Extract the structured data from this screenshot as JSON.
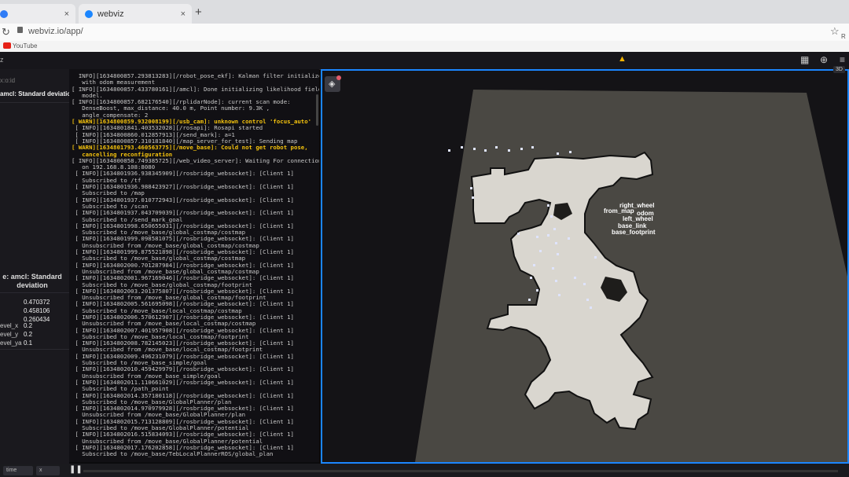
{
  "browser": {
    "tabs": [
      {
        "label": "",
        "favicon_color": "#2f7cf6"
      },
      {
        "label": "webviz",
        "favicon_color": "#1b86ff"
      }
    ],
    "new_tab": "+",
    "close": "×",
    "url": "webviz.io/app/",
    "bookmark": "YouTube",
    "right_partial": "R"
  },
  "app": {
    "title_partial": "z",
    "warning_icon": "warning-triangle-icon"
  },
  "settings": {
    "topic_partial": "x:o:id",
    "header_partial": "amcl: Standard deviation-T",
    "title_line1": "e: amcl: Standard",
    "title_line2": "deviation",
    "values": [
      "0.470372",
      "0.458106",
      "0.260434"
    ],
    "params": [
      {
        "key": "evel_x",
        "value": "0.2"
      },
      {
        "key": "evel_y",
        "value": "0.2"
      },
      {
        "key": "evel_ya",
        "value": "0.1"
      }
    ]
  },
  "log": {
    "lines": [
      {
        "t": "  INFO][1634800857.293813283][/robot_pose_ekf]: Kalman filter initialized",
        "w": false
      },
      {
        "t": "   with odom measurement",
        "w": false
      },
      {
        "t": "[ INFO][1634800857.433780161][/amcl]: Done initializing likelihood field",
        "w": false
      },
      {
        "t": "   model.",
        "w": false
      },
      {
        "t": "[ INFO][1634800857.682176540][/rplidarNode]: current scan mode:",
        "w": false
      },
      {
        "t": "   DenseBoost, max_distance: 40.0 m, Point number: 9.3K ,",
        "w": false
      },
      {
        "t": "   angle_compensate: 2",
        "w": false
      },
      {
        "t": "[ WARN][1634800859.932008199][/usb_cam]: unknown control 'focus_auto'",
        "w": true
      },
      {
        "t": "",
        "w": false
      },
      {
        "t": " [ INFO][1634801841.403532028][/rosapi]: Rosapi started",
        "w": false
      },
      {
        "t": " [ INFO][1634800860.012857913][/send_mark]: a=1",
        "w": false
      },
      {
        "t": " [ INFO][1634800857.310181840][/map_server_for_test]: Sending map",
        "w": false
      },
      {
        "t": "[ WARN][1634801793.460563775][/move_base]: Could not get robot pose,",
        "w": true
      },
      {
        "t": "   cancelling reconfiguration",
        "w": true
      },
      {
        "t": "[ INFO][1634800858.749385725][/web_video_server]: Waiting For connections",
        "w": false
      },
      {
        "t": "   on 192.168.8.108:8080",
        "w": false
      },
      {
        "t": " [ INFO][1634801936.938345909][/rosbridge_websocket]: [Client 1]",
        "w": false
      },
      {
        "t": "   Subscribed to /tf",
        "w": false
      },
      {
        "t": " [ INFO][1634801936.988423927][/rosbridge_websocket]: [Client 1]",
        "w": false
      },
      {
        "t": "   Subscribed to /map",
        "w": false
      },
      {
        "t": " [ INFO][1634801937.010772943][/rosbridge_websocket]: [Client 1]",
        "w": false
      },
      {
        "t": "   Subscribed to /scan",
        "w": false
      },
      {
        "t": " [ INFO][1634801937.043709039][/rosbridge_websocket]: [Client 1]",
        "w": false
      },
      {
        "t": "   Subscribed to /send_mark_goal",
        "w": false
      },
      {
        "t": " [ INFO][1634801998.650655031][/rosbridge_websocket]: [Client 1]",
        "w": false
      },
      {
        "t": "   Subscribed to /move_base/global_costmap/costmap",
        "w": false
      },
      {
        "t": " [ INFO][1634801999.098581075][/rosbridge_websocket]: [Client 1]",
        "w": false
      },
      {
        "t": "   Unsubscribed from /move_base/global_costmap/costmap",
        "w": false
      },
      {
        "t": " [ INFO][1634801999.875521898][/rosbridge_websocket]: [Client 1]",
        "w": false
      },
      {
        "t": "   Subscribed to /move_base/global_costmap/costmap",
        "w": false
      },
      {
        "t": " [ INFO][1634802000.701287984][/rosbridge_websocket]: [Client 1]",
        "w": false
      },
      {
        "t": "   Unsubscribed from /move_base/global_costmap/costmap",
        "w": false
      },
      {
        "t": " [ INFO][1634802001.967169046][/rosbridge_websocket]: [Client 1]",
        "w": false
      },
      {
        "t": "   Subscribed to /move_base/global_costmap/footprint",
        "w": false
      },
      {
        "t": " [ INFO][1634802003.201375807][/rosbridge_websocket]: [Client 1]",
        "w": false
      },
      {
        "t": "   Unsubscribed from /move_base/global_costmap/footprint",
        "w": false
      },
      {
        "t": " [ INFO][1634802005.561695098][/rosbridge_websocket]: [Client 1]",
        "w": false
      },
      {
        "t": "   Subscribed to /move_base/local_costmap/costmap",
        "w": false
      },
      {
        "t": " [ INFO][1634802006.570612907][/rosbridge_websocket]: [Client 1]",
        "w": false
      },
      {
        "t": "   Unsubscribed from /move_base/local_costmap/costmap",
        "w": false
      },
      {
        "t": " [ INFO][1634802007.401957908][/rosbridge_websocket]: [Client 1]",
        "w": false
      },
      {
        "t": "   Subscribed to /move_base/local_costmap/footprint",
        "w": false
      },
      {
        "t": " [ INFO][1634802008.782145023][/rosbridge_websocket]: [Client 1]",
        "w": false
      },
      {
        "t": "   Unsubscribed from /move_base/local_costmap/footprint",
        "w": false
      },
      {
        "t": " [ INFO][1634802009.496231079][/rosbridge_websocket]: [Client 1]",
        "w": false
      },
      {
        "t": "   Subscribed to /move_base_simple/goal",
        "w": false
      },
      {
        "t": " [ INFO][1634802010.459429979][/rosbridge_websocket]: [Client 1]",
        "w": false
      },
      {
        "t": "   Unsubscribed from /move_base_simple/goal",
        "w": false
      },
      {
        "t": " [ INFO][1634802011.110661029][/rosbridge_websocket]: [Client 1]",
        "w": false
      },
      {
        "t": "   Subscribed to /path_point",
        "w": false
      },
      {
        "t": " [ INFO][1634802014.357180118][/rosbridge_websocket]: [Client 1]",
        "w": false
      },
      {
        "t": "   Subscribed to /move_base/GlobalPlanner/plan",
        "w": false
      },
      {
        "t": " [ INFO][1634802014.970979928][/rosbridge_websocket]: [Client 1]",
        "w": false
      },
      {
        "t": "   Unsubscribed from /move_base/GlobalPlanner/plan",
        "w": false
      },
      {
        "t": " [ INFO][1634802015.713128809][/rosbridge_websocket]: [Client 1]",
        "w": false
      },
      {
        "t": "   Subscribed to /move_base/GlobalPlanner/potential",
        "w": false
      },
      {
        "t": " [ INFO][1634802016.515834093][/rosbridge_websocket]: [Client 1]",
        "w": false
      },
      {
        "t": "   Unsubscribed from /move_base/GlobalPlanner/potential",
        "w": false
      },
      {
        "t": " [ INFO][1634802017.176202858][/rosbridge_websocket]: [Client 1]",
        "w": false
      },
      {
        "t": "   Subscribed to /move_base/TebLocalPlannerROS/global_plan",
        "w": false
      }
    ]
  },
  "viewer": {
    "view_mode": "3D",
    "tf_labels": [
      "right_wheel",
      "from_map",
      "odom",
      "left_wheel",
      "base_link",
      "base_footprint"
    ],
    "colors": {
      "accent": "#1b86ff",
      "map_free": "#d9d6cf",
      "map_unknown": "#3a3833",
      "scan": "#dfe4ff"
    }
  },
  "playback": {
    "speed_partial": "x",
    "mode_partial": "time"
  }
}
